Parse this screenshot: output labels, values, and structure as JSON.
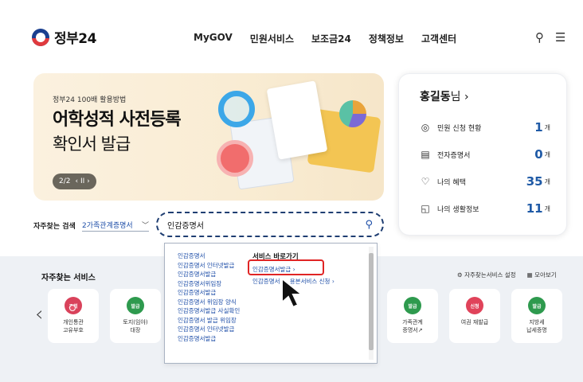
{
  "header": {
    "logo_text": "정부24",
    "nav": [
      "MyGOV",
      "민원서비스",
      "보조금24",
      "정책정보",
      "고객센터"
    ],
    "search_icon": "search-icon",
    "menu_icon": "hamburger-icon"
  },
  "banner": {
    "subtitle": "정부24 100배 활용방법",
    "title_line1": "어학성적 사전등록",
    "title_line2": "확인서 발급",
    "pager_text": "2/2",
    "pager_controls": "‹ II ›"
  },
  "user": {
    "name": "홍길동",
    "suffix": "님 ›",
    "stats": [
      {
        "icon": "search-icon",
        "label": "민원 신청 현황",
        "value": "1",
        "unit": "개"
      },
      {
        "icon": "document-icon",
        "label": "전자증명서",
        "value": "0",
        "unit": "개"
      },
      {
        "icon": "heart-icon",
        "label": "나의 혜택",
        "value": "35",
        "unit": "개"
      },
      {
        "icon": "info-card-icon",
        "label": "나의 생활정보",
        "value": "11",
        "unit": "개"
      }
    ]
  },
  "search": {
    "freq_label": "자주찾는 검색",
    "freq_selected": "2가족관계증명서",
    "query": "인감증명서"
  },
  "services": {
    "title": "자주찾는 서비스",
    "settings_link": "자주찾는서비스 설정",
    "viewall_link": "모아보기",
    "items": [
      {
        "badge": "조회",
        "color": "#d9425b",
        "name": "개인통관\n고유부호"
      },
      {
        "badge": "발급",
        "color": "#2e9a4e",
        "name": "토지(임야)\n대장"
      },
      {
        "badge": "발급",
        "color": "#2e9a4e",
        "name": "가족관계\n증명서↗"
      },
      {
        "badge": "신청",
        "color": "#e0435a",
        "name": "여권 재발급"
      },
      {
        "badge": "발급",
        "color": "#2e9a4e",
        "name": "지방세\n납세증명"
      }
    ]
  },
  "dropdown": {
    "suggestions": [
      "인감증명서",
      "인감증명서 인터넷발급",
      "인감증명서발급",
      "인감증명서위임장",
      "인감증명서발급",
      "인감증명서 위임장 양식",
      "인감증명서발급 사실확인",
      "인감증명서 발급 위임장",
      "인감증명서 인터넷발급",
      "인감증명서발급"
    ],
    "shortcut_title": "서비스 바로가기",
    "shortcuts": [
      "인감증명서발급 ›",
      "인감증명서 … 용본서비스 신청 ›"
    ]
  }
}
